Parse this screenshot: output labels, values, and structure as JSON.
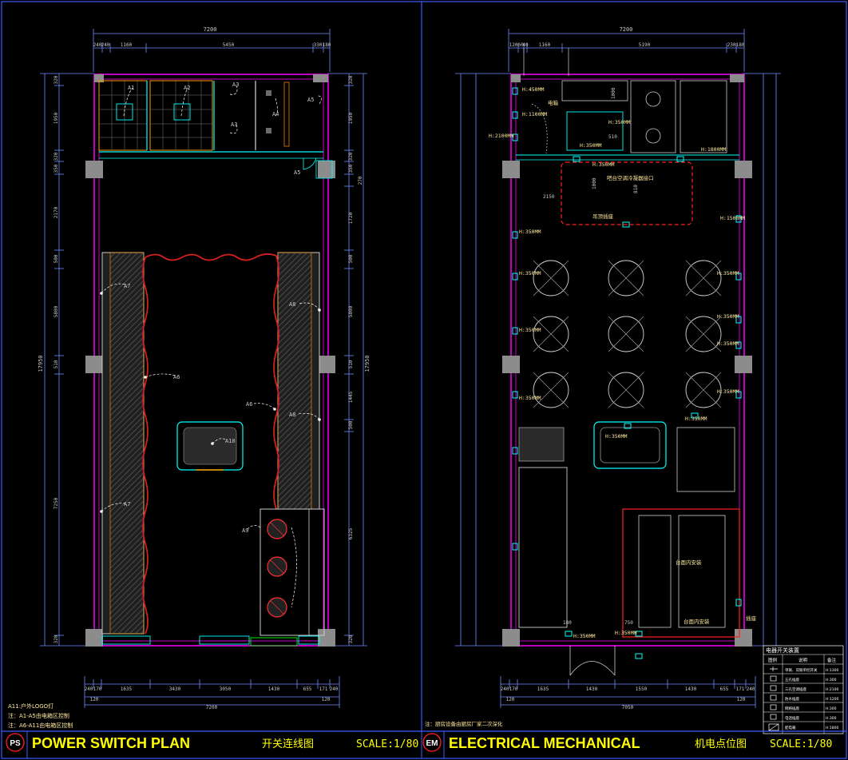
{
  "left_plan": {
    "badge": "PS",
    "title_en": "POWER SWITCH PLAN",
    "title_cn": "开关连线图",
    "scale": "SCALE:1/80",
    "overall_width": "7200",
    "overall_depth": "17950",
    "top_dims": [
      "240",
      "240",
      "1160",
      "5450",
      "330",
      "180"
    ],
    "bottom_dims": [
      "240",
      "170",
      "1635",
      "3430",
      "3050",
      "1430",
      "655",
      "171",
      "240"
    ],
    "bottom_sub": [
      "120",
      "120"
    ],
    "bottom_total": "7200",
    "left_dims": [
      "320",
      "1950",
      "320",
      "350",
      "2170",
      "500",
      "5800",
      "510",
      "7250",
      "320"
    ],
    "right_dims": [
      "320",
      "1950",
      "320",
      "350",
      "270",
      "1720",
      "500",
      "5800",
      "510",
      "1445",
      "500",
      "6325",
      "320"
    ],
    "switch_labels": [
      "A1",
      "A2",
      "A3",
      "A3",
      "A4",
      "A5",
      "A5",
      "A7",
      "A6",
      "A8",
      "A6",
      "A8",
      "A7",
      "A9",
      "A10"
    ],
    "notes": [
      "A11:户外LOGO灯",
      "注：A1-A5由电箱区控制",
      "注：A6-A11由电箱区控制"
    ]
  },
  "right_plan": {
    "badge": "EM",
    "title_en": "ELECTRICAL MECHANICAL",
    "title_cn": "机电点位图",
    "scale": "SCALE:1/80",
    "overall_width": "7200",
    "top_dims": [
      "120",
      "60",
      "40",
      "1160",
      "5190",
      "230",
      "180"
    ],
    "bottom_dims": [
      "240",
      "170",
      "1635",
      "1430",
      "1550",
      "1430",
      "655",
      "171",
      "240"
    ],
    "bottom_sub": [
      "120",
      "120"
    ],
    "bottom_total": "7050",
    "elevation_labels": [
      "H:450MM",
      "H:1100MM",
      "H:2100MM",
      "H:350MM",
      "H:350MM",
      "H:350MM",
      "H:1800MM",
      "H:1500MM",
      "H:350MM",
      "H:350MM",
      "H:350MM",
      "H:350MM",
      "H:350MM",
      "H:350MM",
      "H:350MM",
      "H:350MM",
      "H:350MM",
      "H:350MM",
      "H:350MM",
      "H:350MM"
    ],
    "dims_internal": [
      "2150",
      "1000",
      "810",
      "510",
      "1000",
      "750",
      "180"
    ],
    "room_notes": [
      "电箱",
      "吧台空调冷凝器接口",
      "吊顶插座",
      "台面内安装",
      "台面内安装",
      "插座"
    ],
    "bottom_note": "注：厨房设备由厨房厂家二次深化",
    "legend": {
      "title": "电器开关装置",
      "headers": [
        "图例",
        "说明",
        "备注"
      ],
      "rows": [
        [
          "",
          "单联、双联单控开关",
          "H:1300"
        ],
        [
          "",
          "五孔插座",
          "H:300"
        ],
        [
          "",
          "三孔空调插座",
          "H:2100"
        ],
        [
          "",
          "防水插座",
          "H:1200"
        ],
        [
          "",
          "网络插座",
          "H:300"
        ],
        [
          "",
          "电话插座",
          "H:300"
        ],
        [
          "",
          "配电箱",
          "H:1800"
        ]
      ]
    }
  },
  "colors": {
    "background": "#000000",
    "title_yellow": "#ffff00",
    "wall_magenta": "#ff00ff",
    "dim_blue": "#6e8cff",
    "cyan": "#00ffff",
    "red": "#ff2020",
    "orange": "#ff9900",
    "green": "#00ff00",
    "gray": "#9a9a9a",
    "white": "#ffffff"
  }
}
